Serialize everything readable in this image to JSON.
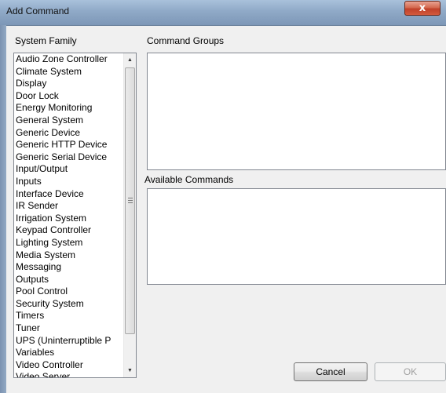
{
  "window": {
    "title": "Add Command",
    "close_glyph": "x"
  },
  "labels": {
    "system_family": "System Family",
    "command_groups": "Command Groups",
    "available_commands": "Available Commands"
  },
  "system_family_list": [
    "Audio Zone Controller",
    "Climate System",
    "Display",
    "Door Lock",
    "Energy Monitoring",
    "General System",
    "Generic Device",
    "Generic HTTP Device",
    "Generic Serial Device",
    "Input/Output",
    "Inputs",
    "Interface Device",
    "IR Sender",
    "Irrigation System",
    "Keypad Controller",
    "Lighting System",
    "Media System",
    "Messaging",
    "Outputs",
    "Pool Control",
    "Security System",
    "Timers",
    "Tuner",
    "UPS (Uninterruptible P",
    "Variables",
    "Video Controller",
    "Video Server"
  ],
  "scrollbar": {
    "up_arrow": "▲",
    "down_arrow": "▼"
  },
  "buttons": {
    "cancel": "Cancel",
    "ok": "OK"
  }
}
